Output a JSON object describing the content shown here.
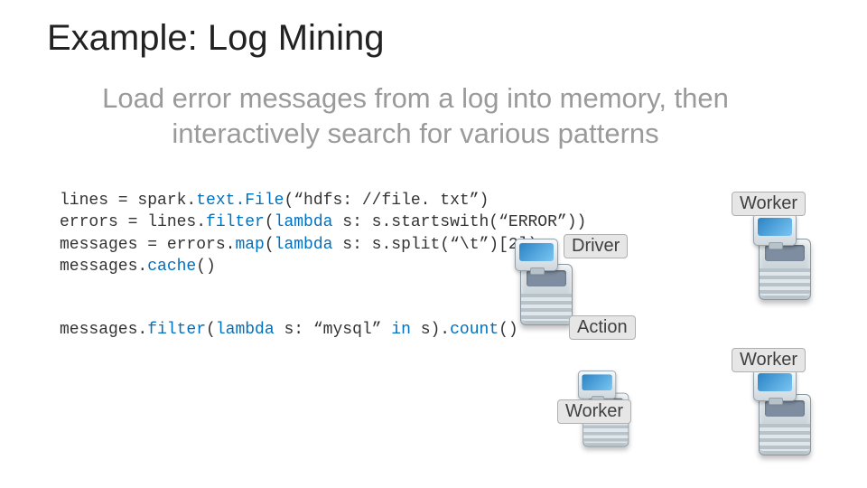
{
  "title": "Example: Log Mining",
  "subtitle": "Load error messages from a log into memory, then interactively search for various patterns",
  "code": {
    "l1a": "lines = spark.",
    "l1b": "text.File",
    "l1c": "(“hdfs: //file. txt”)",
    "l2a": "errors = lines.",
    "l2b": "filter",
    "l2c": "(",
    "l2d": "lambda",
    "l2e": " s: s.startswith(“ERROR”))",
    "l3a": "messages = errors.",
    "l3b": "map",
    "l3c": "(",
    "l3d": "lambda",
    "l3e": " s: s.split(“\\t”)[2])",
    "l4a": "messages.",
    "l4b": "cache",
    "l4c": "()",
    "l5a": "messages.",
    "l5b": "filter",
    "l5c": "(",
    "l5d": "lambda",
    "l5e": " s: “mysql” ",
    "l5f": "in",
    "l5g": " s).",
    "l5h": "count",
    "l5i": "()"
  },
  "labels": {
    "driver": "Driver",
    "action": "Action",
    "worker": "Worker"
  }
}
